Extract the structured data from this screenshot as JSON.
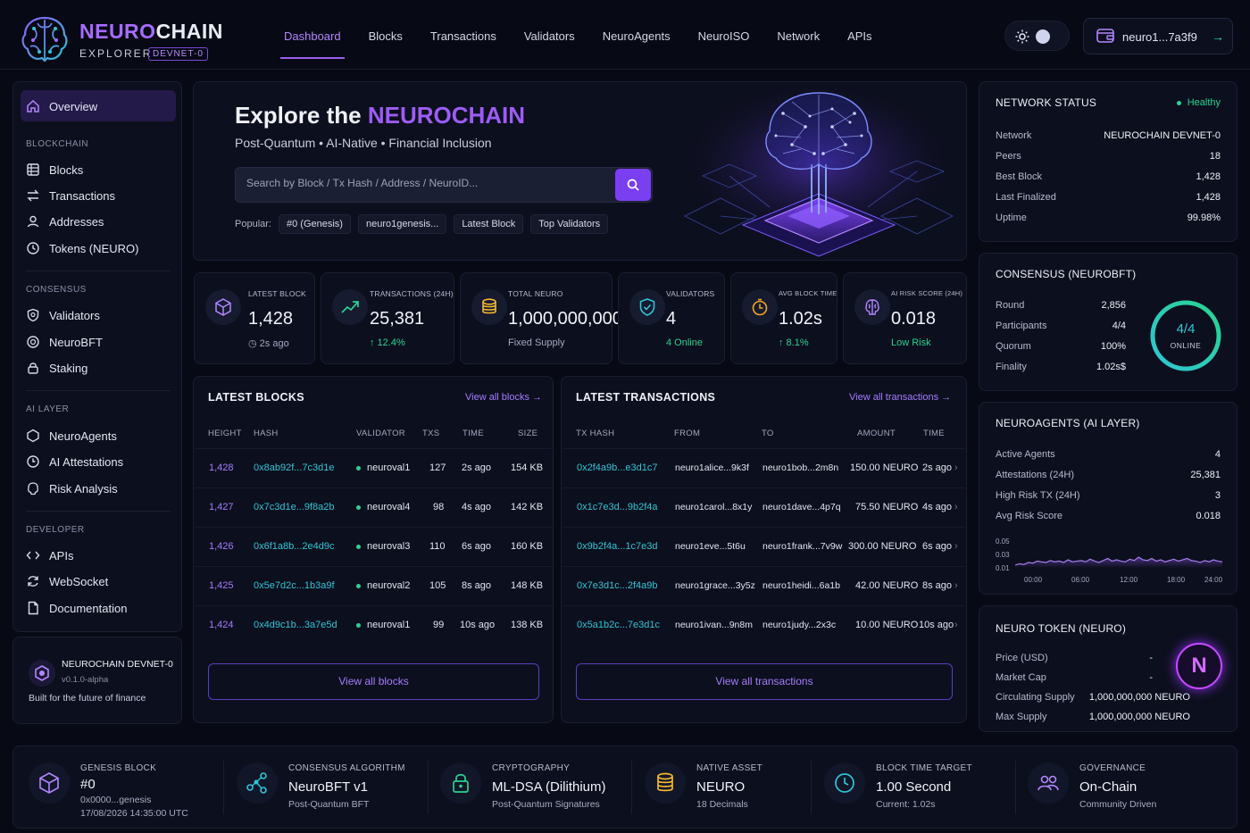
{
  "brand": {
    "name_a": "NEURO",
    "name_b": "CHAIN",
    "subtitle": "EXPLORER",
    "badge": "DEVNET-0"
  },
  "nav": [
    "Dashboard",
    "Blocks",
    "Transactions",
    "Validators",
    "NeuroAgents",
    "NeuroISO",
    "Network",
    "APIs"
  ],
  "wallet": {
    "address": "neuro1...7a3f9"
  },
  "sidebar": {
    "overview": "Overview",
    "blockchain_caption": "BLOCKCHAIN",
    "blockchain": [
      "Blocks",
      "Transactions",
      "Addresses",
      "Tokens (NEURO)"
    ],
    "consensus_caption": "CONSENSUS",
    "consensus": [
      "Validators",
      "NeuroBFT",
      "Staking"
    ],
    "ai_caption": "AI LAYER",
    "ai": [
      "NeuroAgents",
      "AI Attestations",
      "Risk Analysis"
    ],
    "developer_caption": "DEVELOPER",
    "developer": [
      "APIs",
      "WebSocket",
      "Documentation"
    ]
  },
  "devnet_card": {
    "title": "NEUROCHAIN DEVNET-0",
    "version": "v0.1.0-alpha",
    "tagline": "Built for the future of finance"
  },
  "hero": {
    "title_a": "Explore the ",
    "title_b": "NEUROCHAIN",
    "subtitle": "Post-Quantum • AI-Native • Financial Inclusion",
    "search_placeholder": "Search by Block / Tx Hash / Address / NeuroID...",
    "popular_label": "Popular:",
    "popular": [
      "#0 (Genesis)",
      "neuro1genesis...",
      "Latest Block",
      "Top Validators"
    ]
  },
  "stats": [
    {
      "label": "LATEST BLOCK",
      "value": "1,428",
      "sub": "◷ 2s ago",
      "sub_color": "#a3a8bf"
    },
    {
      "label": "TRANSACTIONS (24H)",
      "value": "25,381",
      "sub": "↑ 12.4%",
      "sub_color": "#29d38f"
    },
    {
      "label": "TOTAL NEURO",
      "value": "1,000,000,000",
      "sub": "Fixed Supply",
      "sub_color": "#a3a8bf"
    },
    {
      "label": "VALIDATORS",
      "value": "4",
      "sub": "4 Online",
      "sub_color": "#29d38f"
    },
    {
      "label": "AVG BLOCK TIME",
      "value": "1.02s",
      "sub": "↑ 8.1%",
      "sub_color": "#29d38f"
    },
    {
      "label": "AI RISK SCORE (24H)",
      "value": "0.018",
      "sub": "Low Risk",
      "sub_color": "#29d38f"
    }
  ],
  "latest_blocks": {
    "title": "LATEST BLOCKS",
    "link": "View all blocks →",
    "headers": [
      "HEIGHT",
      "HASH",
      "VALIDATOR",
      "TXS",
      "TIME",
      "SIZE"
    ],
    "rows": [
      [
        "1,428",
        "0x8ab92f...7c3d1e",
        "neuroval1",
        "127",
        "2s ago",
        "154 KB"
      ],
      [
        "1,427",
        "0x7c3d1e...9f8a2b",
        "neuroval4",
        "98",
        "4s ago",
        "142 KB"
      ],
      [
        "1,426",
        "0x6f1a8b...2e4d9c",
        "neuroval3",
        "110",
        "6s ago",
        "160 KB"
      ],
      [
        "1,425",
        "0x5e7d2c...1b3a9f",
        "neuroval2",
        "105",
        "8s ago",
        "148 KB"
      ],
      [
        "1,424",
        "0x4d9c1b...3a7e5d",
        "neuroval1",
        "99",
        "10s ago",
        "138 KB"
      ]
    ],
    "button": "View all blocks"
  },
  "latest_tx": {
    "title": "LATEST TRANSACTIONS",
    "link": "View all transactions →",
    "headers": [
      "TX HASH",
      "FROM",
      "TO",
      "AMOUNT",
      "TIME"
    ],
    "rows": [
      [
        "0x2f4a9b...e3d1c7",
        "neuro1alice...9k3f",
        "neuro1bob...2m8n",
        "150.00 NEURO",
        "2s ago"
      ],
      [
        "0x1c7e3d...9b2f4a",
        "neuro1carol...8x1y",
        "neuro1dave...4p7q",
        "75.50 NEURO",
        "4s ago"
      ],
      [
        "0x9b2f4a...1c7e3d",
        "neuro1eve...5t6u",
        "neuro1frank...7v9w",
        "300.00 NEURO",
        "6s ago"
      ],
      [
        "0x7e3d1c...2f4a9b",
        "neuro1grace...3y5z",
        "neuro1heidi...6a1b",
        "42.00 NEURO",
        "8s ago"
      ],
      [
        "0x5a1b2c...7e3d1c",
        "neuro1ivan...9n8m",
        "neuro1judy...2x3c",
        "10.00 NEURO",
        "10s ago"
      ]
    ],
    "button": "View all transactions"
  },
  "network_status": {
    "title": "NETWORK STATUS",
    "status": "Healthy",
    "rows": [
      [
        "Network",
        "NEUROCHAIN DEVNET-0"
      ],
      [
        "Peers",
        "18"
      ],
      [
        "Best Block",
        "1,428"
      ],
      [
        "Last Finalized",
        "1,428"
      ],
      [
        "Uptime",
        "99.98%"
      ]
    ]
  },
  "consensus": {
    "title": "CONSENSUS (NEUROBFT)",
    "rows": [
      [
        "Round",
        "2,856"
      ],
      [
        "Participants",
        "4/4"
      ],
      [
        "Quorum",
        "100%"
      ],
      [
        "Finality",
        "1.02s$"
      ]
    ],
    "ring_value": "4/4",
    "ring_label": "ONLINE",
    "ring_fraction": 1.0
  },
  "neuroagents": {
    "title": "NEUROAGENTS (AI LAYER)",
    "rows": [
      [
        "Active Agents",
        "4"
      ],
      [
        "Attestations (24H)",
        "25,381"
      ],
      [
        "High Risk TX (24H)",
        "3"
      ],
      [
        "Avg Risk Score",
        "0.018"
      ]
    ],
    "chart": {
      "y_ticks": [
        "0.05",
        "0.03",
        "0.01"
      ],
      "x_ticks": [
        "00:00",
        "06:00",
        "12:00",
        "18:00",
        "24:00"
      ],
      "ylim": [
        0.01,
        0.05
      ],
      "values": [
        0.014,
        0.016,
        0.015,
        0.018,
        0.017,
        0.02,
        0.019,
        0.018,
        0.021,
        0.019,
        0.02,
        0.018,
        0.022,
        0.019,
        0.02,
        0.021,
        0.019,
        0.023,
        0.02,
        0.018,
        0.021,
        0.024,
        0.02,
        0.022,
        0.02,
        0.019,
        0.023,
        0.021,
        0.026,
        0.022,
        0.021,
        0.024,
        0.02,
        0.022,
        0.019,
        0.021,
        0.023,
        0.02,
        0.022,
        0.024,
        0.021,
        0.02,
        0.018,
        0.021,
        0.019,
        0.022,
        0.02,
        0.019
      ]
    }
  },
  "token": {
    "title": "NEURO TOKEN (NEURO)",
    "logo_letter": "N",
    "rows": [
      [
        "Price (USD)",
        "-"
      ],
      [
        "Market Cap",
        "-"
      ],
      [
        "Circulating Supply",
        "1,000,000,000 NEURO"
      ],
      [
        "Max Supply",
        "1,000,000,000 NEURO"
      ]
    ]
  },
  "bottom": [
    {
      "label": "GENESIS BLOCK",
      "value": "#0",
      "sub": "0x0000...genesis",
      "sub2": "17/08/2026 14:35:00 UTC"
    },
    {
      "label": "CONSENSUS ALGORITHM",
      "value": "NeuroBFT v1",
      "sub": "Post-Quantum BFT"
    },
    {
      "label": "CRYPTOGRAPHY",
      "value": "ML-DSA (Dilithium)",
      "sub": "Post-Quantum Signatures"
    },
    {
      "label": "NATIVE ASSET",
      "value": "NEURO",
      "sub": "18 Decimals"
    },
    {
      "label": "BLOCK TIME TARGET",
      "value": "1.00 Second",
      "sub": "Current: 1.02s"
    },
    {
      "label": "GOVERNANCE",
      "value": "On-Chain",
      "sub": "Community Driven"
    }
  ],
  "colors": {
    "accent": "#9d5cf5",
    "cyan": "#2fc5d6",
    "green": "#29d38f",
    "background": "#070914"
  }
}
